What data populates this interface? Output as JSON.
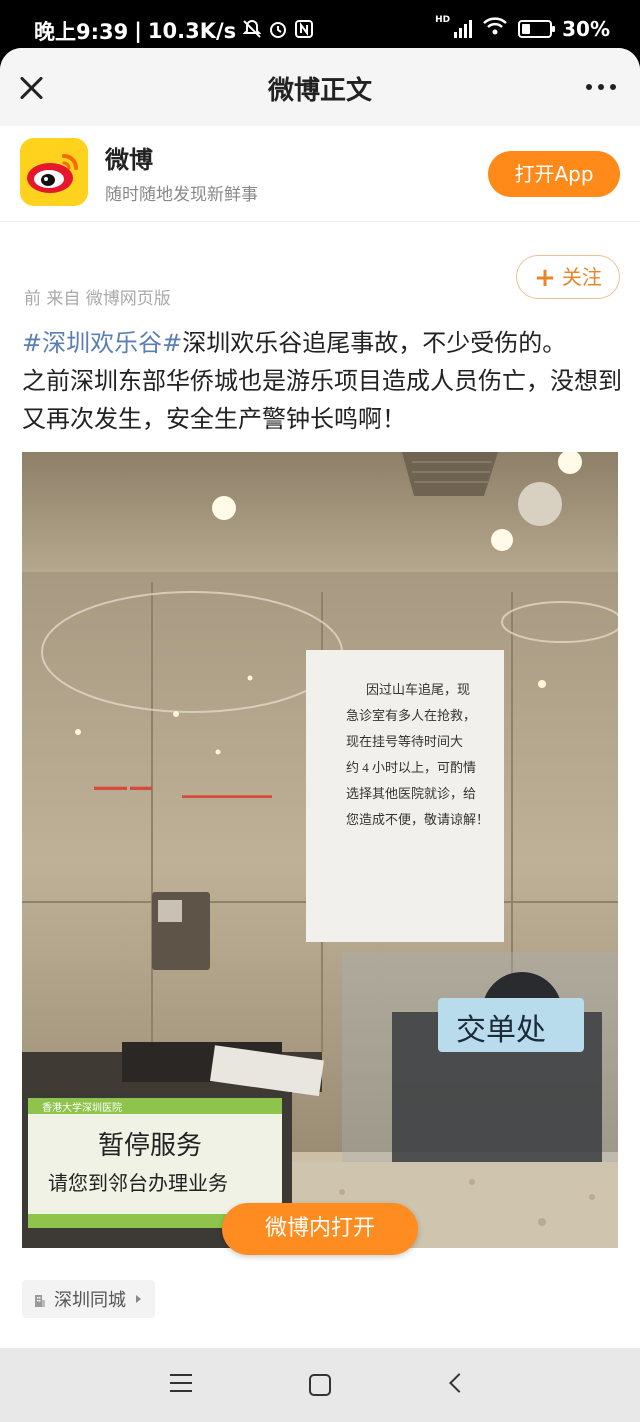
{
  "status_bar": {
    "time": "晚上9:39",
    "net_speed": "10.3K/s",
    "battery": "30%",
    "battery_level": 0.3,
    "icons": [
      "mute-icon",
      "alarm-icon",
      "nfc-icon",
      "hd-icon",
      "signal-icon",
      "wifi-icon",
      "battery-icon"
    ]
  },
  "nav": {
    "title": "微博正文",
    "close_icon": "close-icon",
    "more_icon": "more-icon"
  },
  "app_banner": {
    "name": "微博",
    "slogan": "随时随地发现新鲜事",
    "open_button": "打开App",
    "brand_color": "#ff8a1a"
  },
  "post": {
    "meta": "前 来自 微博网页版",
    "follow_label": "关注",
    "hashtag": "#深圳欢乐谷#",
    "text_line1": "深圳欢乐谷追尾事故，不少受伤的。",
    "text_rest": "之前深圳东部华侨城也是游乐项目造成人员伤亡，没想到又再次发生，安全生产警钟长鸣啊！",
    "image": {
      "notice_text": [
        "因过山车追尾，现",
        "急诊室有多人在抢救，",
        "现在挂号等待时间大",
        "约 4 小时以上，可酌情",
        "选择其他医院就诊，给",
        "您造成不便，敬请谅解！"
      ],
      "window_sign": "交单处",
      "desk_sign_hospital": "香港大学深圳医院",
      "desk_sign_line1": "暂停服务",
      "desk_sign_line2": "请您到邻台办理业务"
    },
    "open_in_weibo": "微博内打开",
    "location": "深圳同城"
  },
  "system_nav": {
    "items": [
      "menu-icon",
      "home-icon",
      "back-icon"
    ]
  }
}
